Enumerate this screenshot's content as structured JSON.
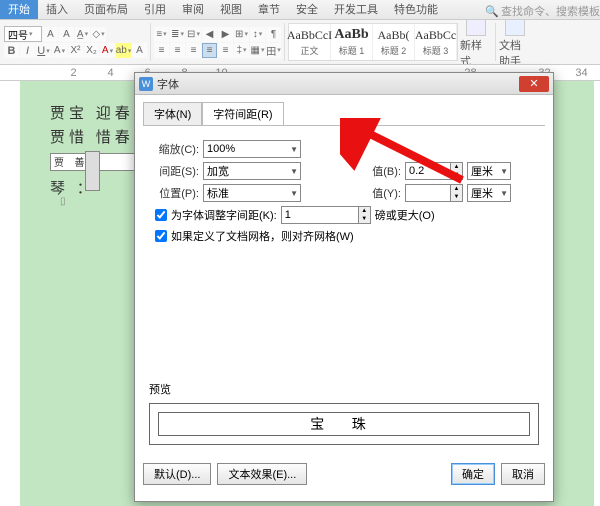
{
  "tabs": {
    "t0": "开始",
    "t1": "插入",
    "t2": "页面布局",
    "t3": "引用",
    "t4": "审阅",
    "t5": "视图",
    "t6": "章节",
    "t7": "安全",
    "t8": "开发工具",
    "t9": "特色功能"
  },
  "search": {
    "icon": "🔍",
    "placeholder": "查找命令、搜索模板"
  },
  "font": {
    "size": "四号"
  },
  "styles": {
    "s0": {
      "samp": "AaBbCcI",
      "lbl": "正文"
    },
    "s1": {
      "samp": "AaBb",
      "lbl": "标题 1"
    },
    "s2": {
      "samp": "AaBb(",
      "lbl": "标题 2"
    },
    "s3": {
      "samp": "AaBbCc",
      "lbl": "标题 3"
    }
  },
  "bigbtns": {
    "b0": "新样式",
    "b1": "文档助手"
  },
  "ruler": {
    "r1": "2",
    "r2": "4",
    "r3": "6",
    "r4": "8",
    "r5": "10",
    "r14": "28",
    "r16": "32",
    "r17": "34"
  },
  "doc": {
    "l1": "贾宝                                迎春",
    "l2": "贾惜                                惜春",
    "l3": "贾                                  善报",
    "l4": "琴 ："
  },
  "dialog": {
    "title": "字体",
    "tab0": "字体(N)",
    "tab1": "字符间距(R)",
    "scale_lbl": "缩放(C):",
    "scale_val": "100%",
    "spacing_lbl": "间距(S):",
    "spacing_val": "加宽",
    "pos_lbl": "位置(P):",
    "pos_val": "标准",
    "valb_lbl": "值(B):",
    "valb_val": "0.2",
    "valb_unit": "厘米",
    "valy_lbl": "值(Y):",
    "valy_unit": "厘米",
    "kern_lbl": "为字体调整字间距(K):",
    "kern_val": "1",
    "kern_unit": "磅或更大(O)",
    "grid_lbl": "如果定义了文档网格，则对齐网格(W)",
    "preview_lbl": "预览",
    "preview_text": "宝 珠",
    "btn_default": "默认(D)...",
    "btn_effect": "文本效果(E)...",
    "btn_ok": "确定",
    "btn_cancel": "取消"
  }
}
